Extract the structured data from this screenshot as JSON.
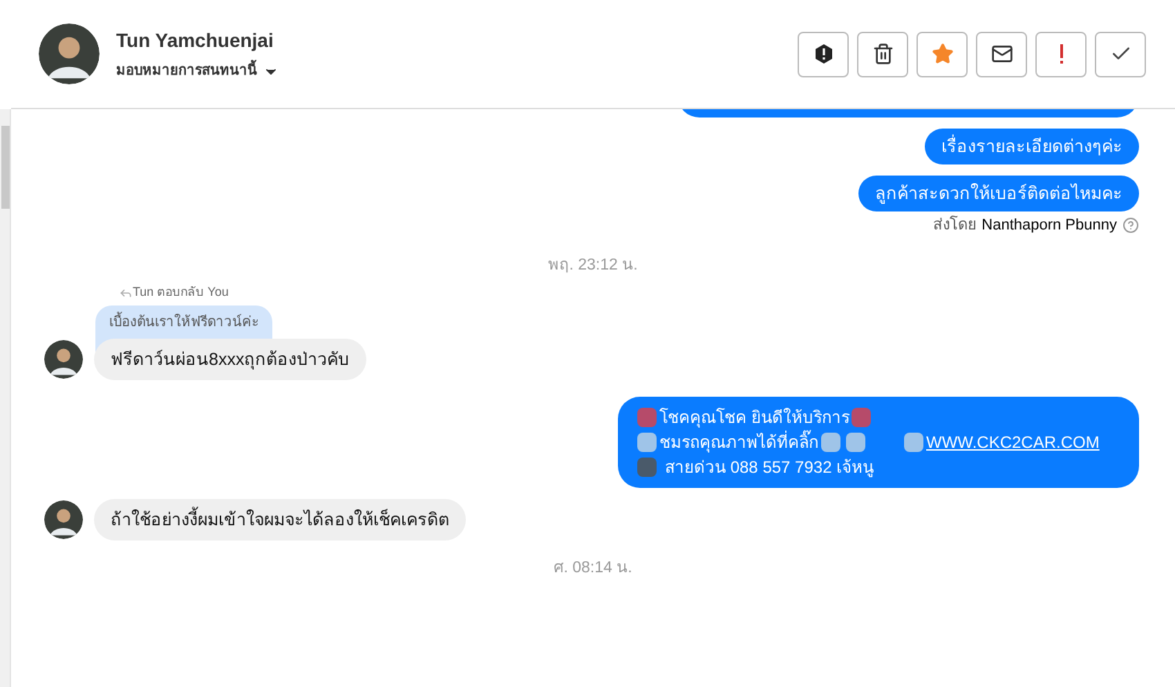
{
  "header": {
    "name": "Tun Yamchuenjai",
    "assign_label": "มอบหมายการสนทนานี้"
  },
  "toolbar": [
    {
      "kind": "alert"
    },
    {
      "kind": "trash"
    },
    {
      "kind": "star",
      "on": true
    },
    {
      "kind": "mail"
    },
    {
      "kind": "important"
    },
    {
      "kind": "done"
    }
  ],
  "messages": [
    {
      "kind": "cut"
    },
    {
      "kind": "outgoing",
      "text": "เรื่องรายละเอียดต่างๆค่ะ"
    },
    {
      "kind": "outgoing",
      "text": "ลูกค้าสะดวกให้เบอร์ติดต่อไหมคะ"
    },
    {
      "kind": "sender",
      "prefix": "ส่งโดย",
      "name": "Nanthaporn Pbunny"
    },
    {
      "kind": "timestamp",
      "text": "พฤ. 23:12 น."
    },
    {
      "kind": "reply_label",
      "text": "Tun ตอบกลับ You"
    },
    {
      "kind": "quote",
      "text": "เบื้องต้นเราให้ฟรีดาวน์ค่ะ"
    },
    {
      "kind": "incoming",
      "text": "ฟรีดาว์นผ่อน8xxxถุกต้องป่าวคับ"
    },
    {
      "kind": "rich",
      "lines": [
        {
          "kind": "greeting",
          "text": "โชคคุณโชค ยินดีให้บริการ"
        },
        {
          "kind": "link",
          "text": "ชมรถคุณภาพได้ที่คลิ๊ก",
          "link": "WWW.CKC2CAR.COM"
        },
        {
          "kind": "phone",
          "text": "สายด่วน 088 557 7932 เจ้หนู"
        }
      ]
    },
    {
      "kind": "incoming",
      "text": "ถ้าใช้อย่างงี้ผมเข้าใจผมจะได้ลองให้เช็คเครดิต"
    },
    {
      "kind": "timestamp",
      "text": "ศ. 08:14 น."
    }
  ]
}
